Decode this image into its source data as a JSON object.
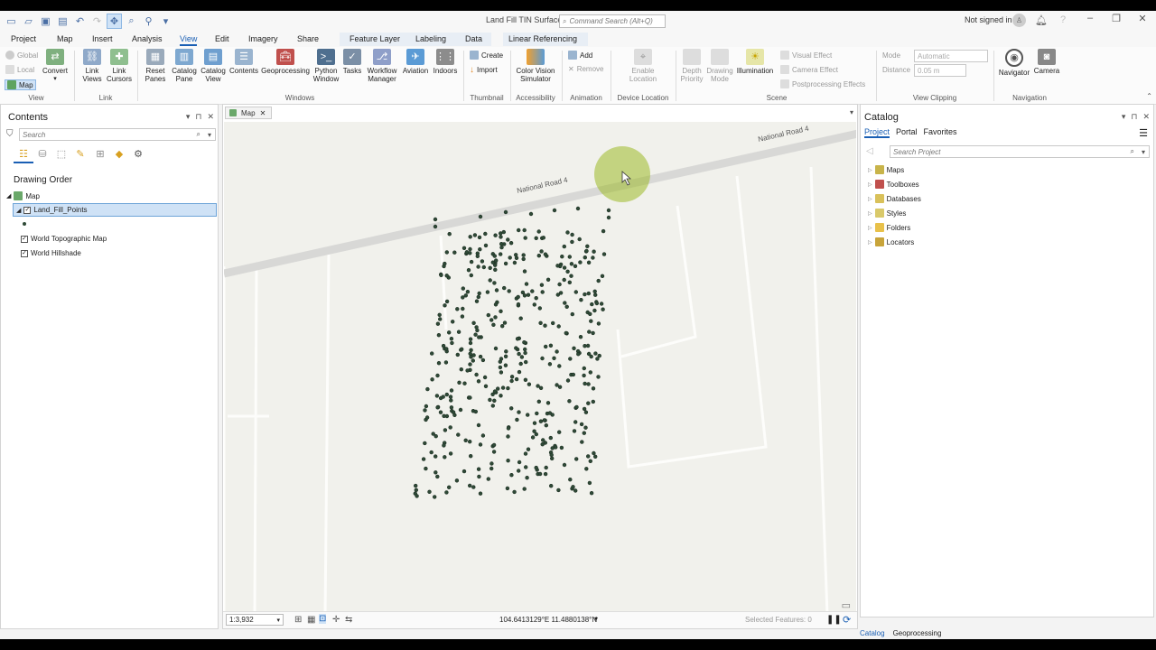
{
  "window": {
    "title": "Land Fill TIN Surface",
    "command_search_placeholder": "Command Search (Alt+Q)",
    "sign_in": "Not signed in"
  },
  "tabs": {
    "main": [
      "Project",
      "Map",
      "Insert",
      "Analysis",
      "View",
      "Edit",
      "Imagery",
      "Share"
    ],
    "active": "View",
    "contextual": [
      "Feature Layer",
      "Labeling",
      "Data"
    ],
    "linear": "Linear Referencing"
  },
  "ribbon": {
    "view_group": {
      "label": "View",
      "global": "Global",
      "local": "Local",
      "map": "Map",
      "convert": "Convert"
    },
    "link_group": {
      "label": "Link",
      "link_views": "Link Views",
      "link_cursors": "Link Cursors"
    },
    "windows_group": {
      "label": "Windows",
      "reset_panes": "Reset Panes",
      "catalog_pane": "Catalog Pane",
      "catalog_view": "Catalog View",
      "contents": "Contents",
      "geoprocessing": "Geoprocessing",
      "python_window": "Python Window",
      "tasks": "Tasks",
      "workflow_manager": "Workflow Manager",
      "aviation": "Aviation",
      "indoors": "Indoors"
    },
    "thumbnail_group": {
      "label": "Thumbnail",
      "create": "Create",
      "import": "Import"
    },
    "accessibility_group": {
      "label": "Accessibility",
      "color_vision": "Color Vision Simulator"
    },
    "animation_group": {
      "label": "Animation",
      "add": "Add",
      "remove": "Remove"
    },
    "device_group": {
      "label": "Device Location",
      "enable": "Enable Location"
    },
    "scene_group": {
      "label": "Scene",
      "depth_priority": "Depth Priority",
      "drawing_mode": "Drawing Mode",
      "illumination": "Illumination",
      "visual_effect": "Visual Effect",
      "camera_effect": "Camera Effect",
      "postprocessing": "Postprocessing Effects"
    },
    "clipping_group": {
      "label": "View Clipping",
      "mode_label": "Mode",
      "mode_value": "Automatic",
      "distance_label": "Distance",
      "distance_value": "0.05 m"
    },
    "navigation_group": {
      "label": "Navigation",
      "navigator": "Navigator",
      "camera": "Camera"
    }
  },
  "contents": {
    "title": "Contents",
    "search_placeholder": "Search",
    "section": "Drawing Order",
    "map": "Map",
    "layers": [
      "Land_Fill_Points",
      "World Topographic Map",
      "World Hillshade"
    ]
  },
  "map_view": {
    "tab": "Map",
    "road_label": "National Road 4",
    "scale": "1:3,932",
    "coordinates": "104.6413129°E 11.4880138°N",
    "selected_features": "Selected Features: 0"
  },
  "catalog": {
    "title": "Catalog",
    "tabs": [
      "Project",
      "Portal",
      "Favorites"
    ],
    "search_placeholder": "Search Project",
    "items": [
      "Maps",
      "Toolboxes",
      "Databases",
      "Styles",
      "Folders",
      "Locators"
    ]
  },
  "bottom_tabs": [
    "Catalog",
    "Geoprocessing"
  ],
  "colors": {
    "accent": "#1a5fb4",
    "points": "#2f4a37",
    "highlight": "#9cba28"
  }
}
